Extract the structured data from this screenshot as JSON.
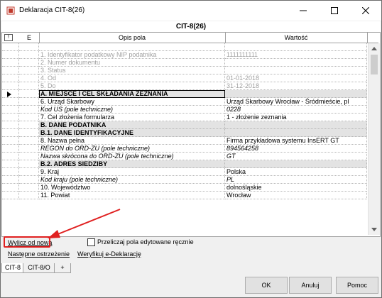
{
  "window": {
    "title": "Deklaracja CIT-8(26)"
  },
  "caption": "CIT-8(26)",
  "grid": {
    "headers": {
      "marker": "!",
      "col_e": "E",
      "col_desc": "Opis pola",
      "col_value": "Wartość"
    },
    "rows": [
      {
        "desc": "",
        "value": ""
      },
      {
        "desc": "1. Identyfikator podatkowy NIP podatnika",
        "value": "1111111111"
      },
      {
        "desc": "2. Numer dokumentu",
        "value": ""
      },
      {
        "desc": "3. Status",
        "value": ""
      },
      {
        "desc": "4. Od",
        "value": "01-01-2018"
      },
      {
        "desc": "5. Do",
        "value": "31-12-2018"
      },
      {
        "desc": "A.  MIEJSCE I CEL SKŁADANIA ZEZNANIA",
        "value": ""
      },
      {
        "desc": "6. Urząd Skarbowy",
        "value": "Urząd Skarbowy Wrocław - Śródmieście, pl"
      },
      {
        "desc": "Kod US (pole techniczne)",
        "value": "0228"
      },
      {
        "desc": "7. Cel złożenia formularza",
        "value": "1 - złożenie zeznania"
      },
      {
        "desc": "B. DANE PODATNIKA",
        "value": ""
      },
      {
        "desc": "B.1. DANE IDENTYFIKACYJNE",
        "value": ""
      },
      {
        "desc": "8. Nazwa pełna",
        "value": "Firma przykładowa systemu InsERT GT"
      },
      {
        "desc": "REGON do ORD-ZU (pole techniczne)",
        "value": "894564258"
      },
      {
        "desc": "Nazwa skrócona do ORD-ZU (pole techniczne)",
        "value": "GT"
      },
      {
        "desc": "B.2. ADRES SIEDZIBY",
        "value": ""
      },
      {
        "desc": "9. Kraj",
        "value": "Polska"
      },
      {
        "desc": "Kod kraju (pole techniczne)",
        "value": "PL"
      },
      {
        "desc": "10. Województwo",
        "value": "dolnośląskie"
      },
      {
        "desc": "11. Powiat",
        "value": "Wrocław"
      }
    ]
  },
  "links": {
    "recalc": "Wylicz od nowa",
    "next_warning": "Następne ostrzeżenie",
    "verify": "Weryfikuj e-Deklarację"
  },
  "checkbox": {
    "label": "Przeliczaj pola edytowane ręcznie",
    "checked": false
  },
  "tabs": [
    "CIT-8",
    "CIT-8/O",
    "+"
  ],
  "buttons": {
    "ok": "OK",
    "cancel": "Anuluj",
    "help": "Pomoc"
  },
  "colors": {
    "highlight": "#e02020",
    "section_bg": "#e3e3e3"
  },
  "annotation": {
    "type": "red-arrow",
    "target": "recalc-link"
  }
}
